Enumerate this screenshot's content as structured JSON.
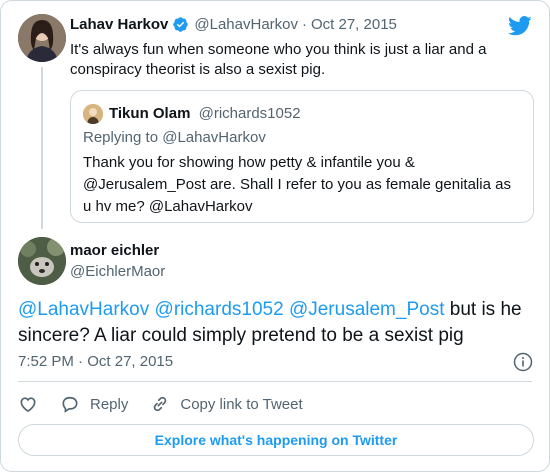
{
  "parent_tweet": {
    "name": "Lahav Harkov",
    "handle": "@LahavHarkov",
    "separator": "·",
    "date": "Oct 27, 2015",
    "text": "It's always fun when someone who you think is just a liar and a conspiracy theorist is also a sexist pig.",
    "verified_icon": "verified-badge-icon",
    "avatar_icon": "avatar"
  },
  "quoted_tweet": {
    "name": "Tikun Olam",
    "handle": "@richards1052",
    "replying_to": "Replying to @LahavHarkov",
    "text": "Thank you for showing how petty & infantile you & @Jerusalem_Post are. Shall I refer to you as female genitalia as u hv me? @LahavHarkov"
  },
  "main_tweet": {
    "name": "maor eichler",
    "handle": "@EichlerMaor",
    "mentions": [
      "@LahavHarkov",
      "@richards1052",
      "@Jerusalem_Post"
    ],
    "text_rest": " but is he sincere? A liar could simply pretend to be a sexist pig",
    "time": "7:52 PM",
    "separator": "·",
    "date": "Oct 27, 2015"
  },
  "actions": {
    "like_icon": "heart-icon",
    "reply_label": "Reply",
    "copy_label": "Copy link to Tweet"
  },
  "explore_label": "Explore what's happening on Twitter",
  "colors": {
    "accent": "#1d9bf0",
    "secondary_text": "#536471",
    "border": "#cfd9de"
  }
}
